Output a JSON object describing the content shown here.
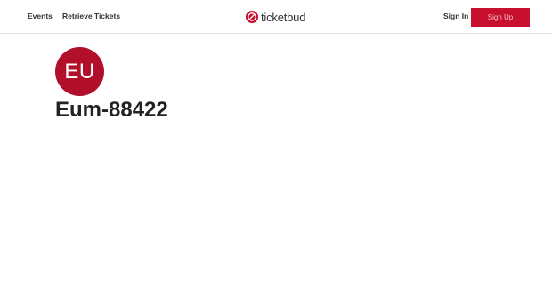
{
  "header": {
    "nav": {
      "events_label": "Events",
      "retrieve_tickets_label": "Retrieve Tickets"
    },
    "logo_text": "ticketbud",
    "sign_in_label": "Sign In",
    "sign_up_label": "Sign Up"
  },
  "profile": {
    "avatar_initials": "EU",
    "username": "Eum-88422"
  },
  "colors": {
    "brand_red": "#c8102e",
    "avatar_red": "#b2102a"
  },
  "icons": {
    "logo_icon": "ticketbud-logo-icon"
  }
}
